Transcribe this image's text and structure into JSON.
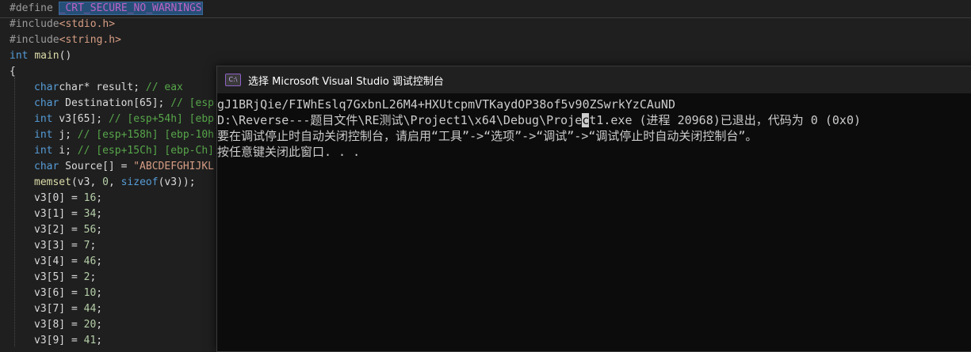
{
  "editor": {
    "line1": {
      "directive": "#define ",
      "macro": "_CRT_SECURE_NO_WARNINGS"
    },
    "line2": {
      "directive": "#include",
      "header": "<stdio.h>"
    },
    "line3": {
      "directive": "#include",
      "header": "<string.h>"
    },
    "line4": {
      "type": "int",
      "name": "main",
      "parens": "()"
    },
    "line5": "{",
    "line6": {
      "code": "char* result; ",
      "comment": "// eax"
    },
    "line7": {
      "type": "char",
      "code": " Destination[65]; ",
      "comment": "// [esp"
    },
    "line8": {
      "type": "int",
      "code": " v3[65]; ",
      "comment": "// [esp+54h] [ebp"
    },
    "line9": {
      "type": "int",
      "code": " j; ",
      "comment": "// [esp+158h] [ebp-10h"
    },
    "line10": {
      "type": "int",
      "code": " i; ",
      "comment": "// [esp+15Ch] [ebp-Ch]"
    },
    "line11": {
      "type": "char",
      "code": " Source[] = ",
      "string": "\"ABCDEFGHIJKL"
    },
    "line12": {
      "fn": "memset",
      "code_a": "(v3, ",
      "num": "0",
      "code_b": ", ",
      "kw": "sizeof",
      "code_c": "(v3));"
    },
    "assignments": [
      {
        "lhs": "v3[0] = ",
        "value": "16",
        "end": ";"
      },
      {
        "lhs": "v3[1] = ",
        "value": "34",
        "end": ";"
      },
      {
        "lhs": "v3[2] = ",
        "value": "56",
        "end": ";"
      },
      {
        "lhs": "v3[3] = ",
        "value": "7",
        "end": ";"
      },
      {
        "lhs": "v3[4] = ",
        "value": "46",
        "end": ";"
      },
      {
        "lhs": "v3[5] = ",
        "value": "2",
        "end": ";"
      },
      {
        "lhs": "v3[6] = ",
        "value": "10",
        "end": ";"
      },
      {
        "lhs": "v3[7] = ",
        "value": "44",
        "end": ";"
      },
      {
        "lhs": "v3[8] = ",
        "value": "20",
        "end": ";"
      },
      {
        "lhs": "v3[9] = ",
        "value": "41",
        "end": ";"
      }
    ]
  },
  "console": {
    "icon_label": "C:\\",
    "title": "选择 Microsoft Visual Studio 调试控制台",
    "output_line1": "gJ1BRjQie/FIWhEslq7GxbnL26M4+HXUtcpmVTKaydOP38of5v90ZSwrkYzCAuND",
    "output_line2_before": "D:\\Reverse---题目文件\\RE测试\\Project1\\x64\\Debug\\Proje",
    "output_line2_cursor": "c",
    "output_line2_after": "t1.exe (进程 20968)已退出，代码为 0 (0x0)",
    "output_line3": "要在调试停止时自动关闭控制台，请启用“工具”->“选项”->“调试”->“调试停止时自动关闭控制台”。",
    "output_line4": "按任意键关闭此窗口. . ."
  },
  "colors": {
    "editor_bg": "#1f1f1f",
    "console_bg": "#0c0c0c",
    "keyword": "#569cd6",
    "comment": "#57a64a",
    "string": "#d69d85",
    "selection": "#264f78"
  }
}
